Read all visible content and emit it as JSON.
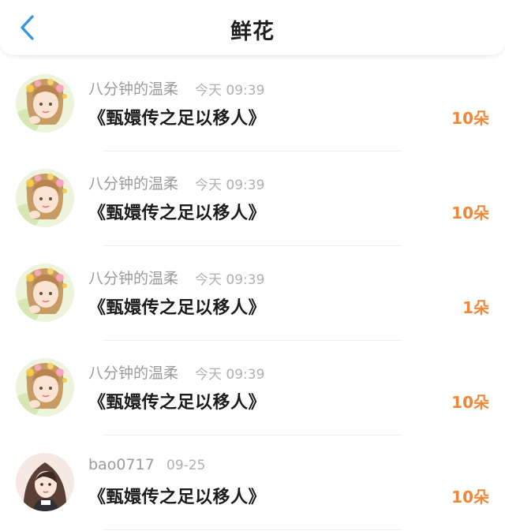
{
  "header": {
    "title": "鲜花",
    "back_icon": "chevron-left-icon",
    "accent_color": "#2f95e8"
  },
  "flowers": [
    {
      "avatar": "floral-girl-avatar",
      "name": "八分钟的温柔",
      "time": "今天 09:39",
      "book": "《甄嬛传之足以移人》",
      "count": "10朵"
    },
    {
      "avatar": "floral-girl-avatar",
      "name": "八分钟的温柔",
      "time": "今天 09:39",
      "book": "《甄嬛传之足以移人》",
      "count": "10朵"
    },
    {
      "avatar": "floral-girl-avatar",
      "name": "八分钟的温柔",
      "time": "今天 09:39",
      "book": "《甄嬛传之足以移人》",
      "count": "1朵"
    },
    {
      "avatar": "floral-girl-avatar",
      "name": "八分钟的温柔",
      "time": "今天 09:39",
      "book": "《甄嬛传之足以移人》",
      "count": "10朵"
    },
    {
      "avatar": "hooded-girl-avatar",
      "name": "bao0717",
      "time": "09-25",
      "book": "《甄嬛传之足以移人》",
      "count": "10朵"
    }
  ],
  "colors": {
    "count": "#f0883a",
    "name": "#9b9b9b",
    "title": "#1c1c1c"
  }
}
